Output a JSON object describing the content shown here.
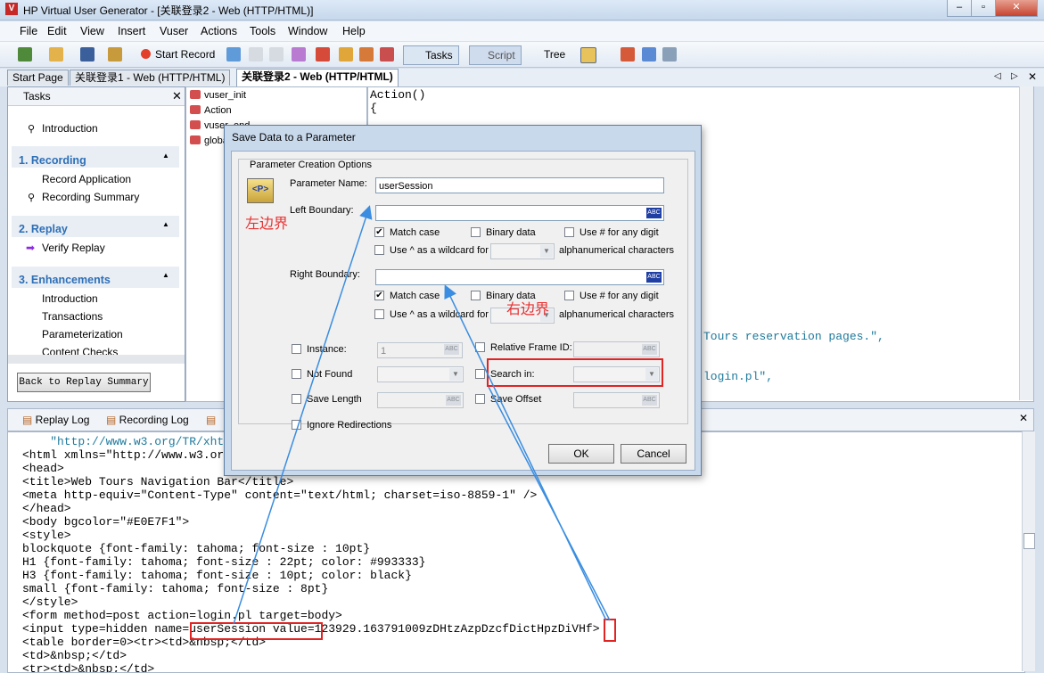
{
  "window": {
    "title": "HP Virtual User Generator - [关联登录2 - Web (HTTP/HTML)]",
    "app_icon": "vugen-icon"
  },
  "menubar": [
    "File",
    "Edit",
    "View",
    "Insert",
    "Vuser",
    "Actions",
    "Tools",
    "Window",
    "Help"
  ],
  "toolbar": {
    "start_record": "Start Record",
    "tasks": "Tasks",
    "script": "Script",
    "tree": "Tree"
  },
  "doc_tabs": [
    "Start Page",
    "关联登录1 - Web (HTTP/HTML)",
    "关联登录2 - Web (HTTP/HTML)"
  ],
  "tasks_pane": {
    "header": "Tasks",
    "intro": "Introduction",
    "sections": [
      {
        "title": "1. Recording",
        "items": [
          "Record Application",
          "Recording Summary"
        ]
      },
      {
        "title": "2. Replay",
        "items": [
          "Verify Replay"
        ]
      },
      {
        "title": "3. Enhancements",
        "items": [
          "Introduction",
          "Transactions",
          "Parameterization",
          "Content Checks"
        ]
      }
    ],
    "back_button": "Back to Replay Summary"
  },
  "tree": {
    "items": [
      "vuser_init",
      "Action",
      "vuser_end",
      "globals.h"
    ]
  },
  "editor": {
    "lines": [
      "Action()",
      "{"
    ],
    "fragment1": "Tours reservation pages.\",",
    "fragment2": "login.pl\","
  },
  "bottom_tabs": [
    "Replay Log",
    "Recording Log"
  ],
  "log_lines": [
    "    \"http://www.w3.org/TR/xhtml1/DTD/xhtml1-transitional.dtd\">",
    "<html xmlns=\"http://www.w3.org/1999/xhtml\">",
    "<head>",
    "<title>Web Tours Navigation Bar</title>",
    "<meta http-equiv=\"Content-Type\" content=\"text/html; charset=iso-8859-1\" />",
    "</head>",
    "<body bgcolor=\"#E0E7F1\">",
    "<style>",
    "blockquote {font-family: tahoma; font-size : 10pt}",
    "H1 {font-family: tahoma; font-size : 22pt; color: #993333}",
    "H3 {font-family: tahoma; font-size : 10pt; color: black}",
    "small {font-family: tahoma; font-size : 8pt}",
    "</style>",
    "<form method=post action=login.pl target=body>",
    "<input type=hidden name=userSession value=123929.163791009zDHtzAzpDzcfDictHpzDiVHf>",
    "<table border=0><tr><td>&nbsp;</td>",
    "<td>&nbsp;</td>",
    "<tr><td>&nbsp;</td>"
  ],
  "dialog": {
    "title": "Save Data to a Parameter",
    "group": "Parameter Creation Options",
    "param_name_label": "Parameter Name:",
    "param_name_value": "userSession",
    "left_boundary_label": "Left Boundary:",
    "right_boundary_label": "Right Boundary:",
    "match_case": "Match case",
    "binary_data": "Binary data",
    "use_hash": "Use # for any digit",
    "use_caret": "Use ^ as a wildcard for",
    "alnum": "alphanumerical characters",
    "instance": "Instance:",
    "instance_value": "1",
    "relative_frame": "Relative Frame ID:",
    "not_found": "Not Found",
    "search_in": "Search in:",
    "save_length": "Save Length",
    "save_offset": "Save Offset",
    "ignore_redirections": "Ignore Redirections",
    "ok": "OK",
    "cancel": "Cancel"
  },
  "annotations": {
    "left": "左边界",
    "right": "右边界",
    "color": "#e83232",
    "arrow_color": "#3a8de0"
  }
}
